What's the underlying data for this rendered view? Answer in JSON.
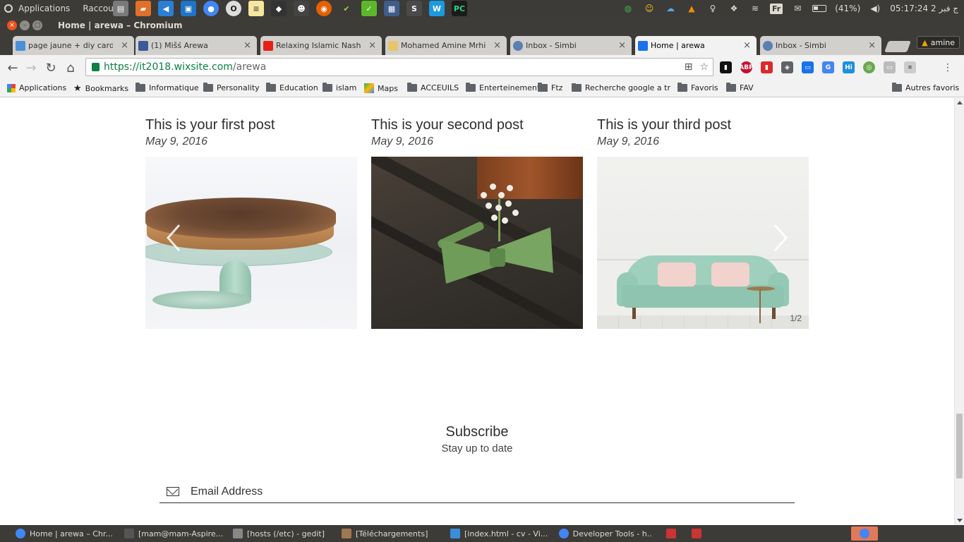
{
  "system_panel": {
    "applications": "Applications",
    "shortcuts": "Raccourcis",
    "battery": "(41%)",
    "clock": "05:17:24 2 ج فبر",
    "keyboard": "Fr"
  },
  "window": {
    "title": "Home | arewa – Chromium"
  },
  "tabs": [
    {
      "label": "page jaune + diy card v",
      "favicon_color": "#4a90d9"
    },
    {
      "label": "(1) Mišś Arewa",
      "favicon_color": "#3b5998"
    },
    {
      "label": "Relaxing Islamic Nashe",
      "favicon_color": "#e62117"
    },
    {
      "label": "Mohamed Amine Mrhili",
      "favicon_color": "#e8c46a"
    },
    {
      "label": "Inbox - Simbi",
      "favicon_color": "#5b7fb1"
    },
    {
      "label": "Home | arewa",
      "favicon_color": "#1a73e8",
      "active": true
    },
    {
      "label": "Inbox - Simbi",
      "favicon_color": "#5b7fb1"
    }
  ],
  "profile": {
    "name": "amine"
  },
  "omnibox": {
    "host": "https://it2018.wixsite.com",
    "path": "/arewa"
  },
  "bookmarks": [
    {
      "label": "Applications",
      "type": "apps"
    },
    {
      "label": "Bookmarks",
      "type": "star"
    },
    {
      "label": "Informatique",
      "type": "folder"
    },
    {
      "label": "Personality",
      "type": "folder"
    },
    {
      "label": "Education",
      "type": "folder"
    },
    {
      "label": "islam",
      "type": "folder"
    },
    {
      "label": "Maps",
      "type": "maps"
    },
    {
      "label": "ACCEUILS",
      "type": "folder"
    },
    {
      "label": "Enterteinement",
      "type": "folder"
    },
    {
      "label": "Ftz",
      "type": "folder"
    },
    {
      "label": "Recherche google a tr",
      "type": "folder"
    },
    {
      "label": "Favoris",
      "type": "folder"
    },
    {
      "label": "FAV",
      "type": "folder"
    },
    {
      "label": "Autres favoris",
      "type": "folder"
    }
  ],
  "posts": [
    {
      "title": "This is your first post",
      "date": "May 9, 2016"
    },
    {
      "title": "This is your second post",
      "date": "May 9, 2016"
    },
    {
      "title": "This is your third post",
      "date": "May 9, 2016"
    }
  ],
  "gallery": {
    "pager": "1/2"
  },
  "subscribe": {
    "title": "Subscribe",
    "subtitle": "Stay up to date",
    "email_placeholder": "Email Address"
  },
  "taskbar": [
    {
      "label": "Home | arewa – Chr...",
      "icon_color": "#4285f4"
    },
    {
      "label": "[mam@mam-Aspire...",
      "icon_color": "#555"
    },
    {
      "label": "[hosts (/etc) - gedit]",
      "icon_color": "#888"
    },
    {
      "label": "[Téléchargements]",
      "icon_color": "#a07850"
    },
    {
      "label": "[index.html - cv - Vi...",
      "icon_color": "#3c8dd9"
    },
    {
      "label": "Developer Tools - h...",
      "icon_color": "#4285f4"
    }
  ]
}
